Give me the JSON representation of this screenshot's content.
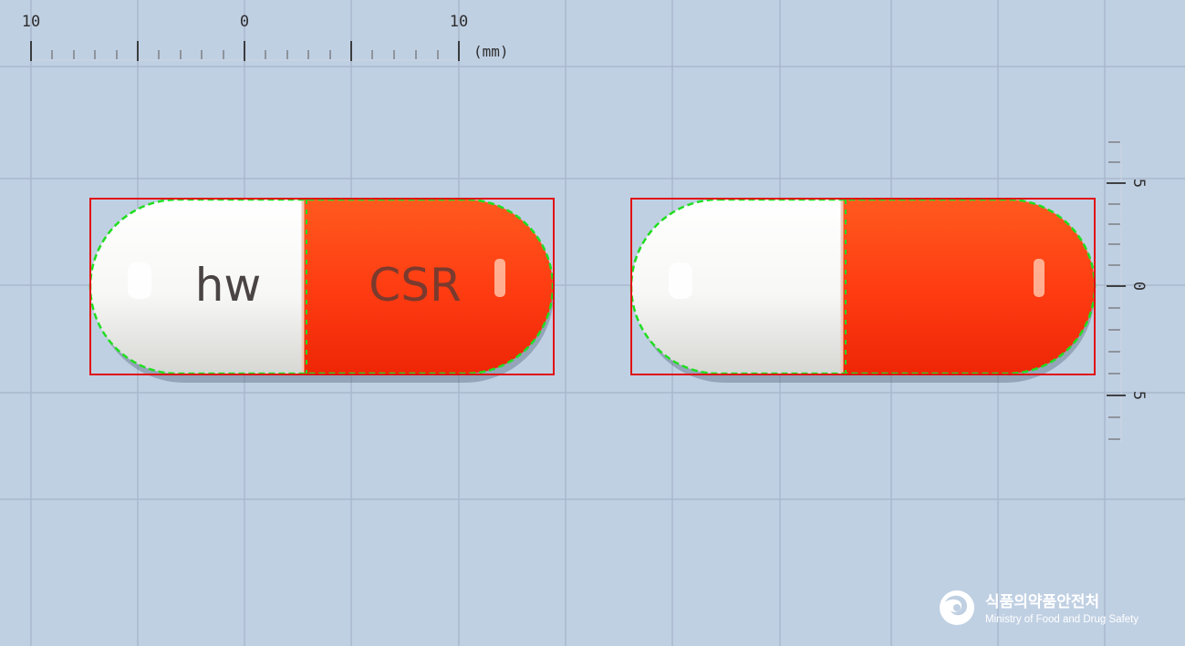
{
  "ruler": {
    "top_labels": [
      "10",
      "0",
      "10"
    ],
    "unit": "(mm)",
    "right_labels": [
      "5",
      "0",
      "5"
    ]
  },
  "pills": [
    {
      "name": "pill-front",
      "left_imprint": "hw",
      "right_imprint": "CSR",
      "left_color": "#f6f6f4",
      "right_color": "#ff3a12"
    },
    {
      "name": "pill-back",
      "left_imprint": "",
      "right_imprint": "",
      "left_color": "#f6f6f4",
      "right_color": "#ff3a12"
    }
  ],
  "colors": {
    "background": "#c0d0e3",
    "grid": "#a9b8cc",
    "bounding_box": "#e01010",
    "contour": "#22dd22"
  },
  "logo": {
    "icon": "mfds-emblem-icon",
    "korean": "식품의약품안전처",
    "english": "Ministry of Food and Drug Safety"
  }
}
